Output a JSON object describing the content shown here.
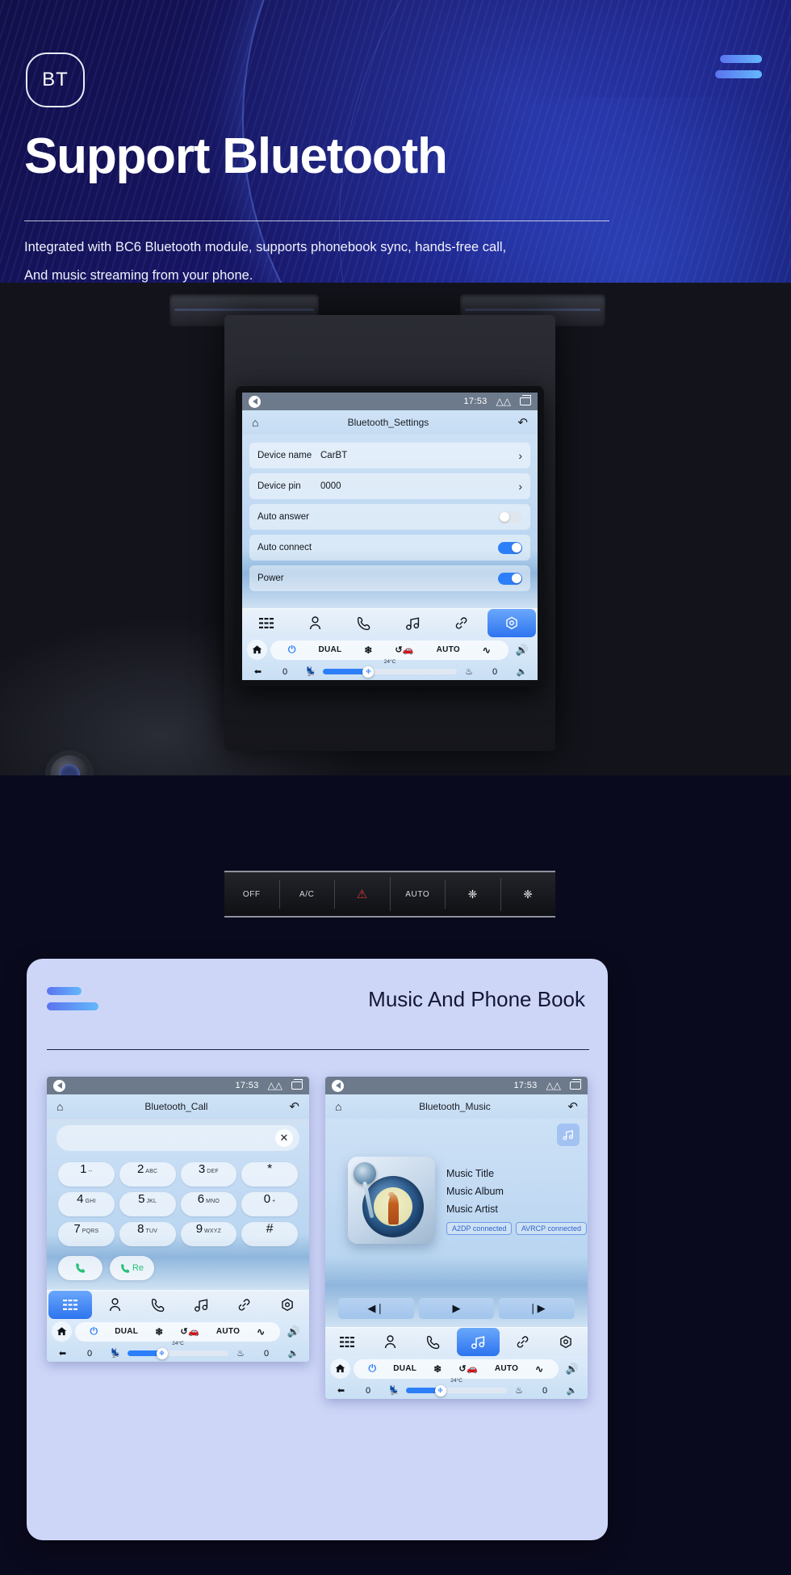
{
  "hero": {
    "badge": "BT",
    "title": "Support Bluetooth",
    "subtitle_line1": "Integrated with BC6 Bluetooth module, supports phonebook sync, hands-free call,",
    "subtitle_line2": "And music streaming from your phone.",
    "accent": "#5b74f0",
    "accent2": "#63b8fb",
    "bg": "#161460"
  },
  "car_hvac": {
    "buttons": [
      "OFF",
      "A/C",
      "⚠",
      "AUTO",
      "❈",
      "❈"
    ]
  },
  "settings_screen": {
    "status": {
      "time": "17:53"
    },
    "title": "Bluetooth_Settings",
    "rows": [
      {
        "label": "Device name",
        "value": "CarBT",
        "type": "chevron"
      },
      {
        "label": "Device pin",
        "value": "0000",
        "type": "chevron"
      },
      {
        "label": "Auto answer",
        "value": "",
        "type": "toggle",
        "on": false
      },
      {
        "label": "Auto connect",
        "value": "",
        "type": "toggle",
        "on": true
      },
      {
        "label": "Power",
        "value": "",
        "type": "toggle",
        "on": true
      }
    ],
    "dock_active": "settings",
    "climate": {
      "dual": "DUAL",
      "auto": "AUTO",
      "temp": "24°C",
      "left_level": "0",
      "right_level": "0"
    }
  },
  "card": {
    "title": "Music And Phone Book"
  },
  "call_screen": {
    "status": {
      "time": "17:53"
    },
    "title": "Bluetooth_Call",
    "search_value": "",
    "keys": [
      {
        "d": "1",
        "s": "--"
      },
      {
        "d": "2",
        "s": "ABC"
      },
      {
        "d": "3",
        "s": "DEF"
      },
      {
        "d": "*",
        "s": ""
      },
      {
        "d": "4",
        "s": "GHI"
      },
      {
        "d": "5",
        "s": "JKL"
      },
      {
        "d": "6",
        "s": "MNO"
      },
      {
        "d": "0",
        "s": "+"
      },
      {
        "d": "7",
        "s": "PQRS"
      },
      {
        "d": "8",
        "s": "TUV"
      },
      {
        "d": "9",
        "s": "WXYZ"
      },
      {
        "d": "#",
        "s": ""
      }
    ],
    "call_label": "",
    "redial_label": "Re",
    "dock_active": "apps",
    "climate": {
      "dual": "DUAL",
      "auto": "AUTO",
      "temp": "24°C",
      "left_level": "0",
      "right_level": "0"
    }
  },
  "music_screen": {
    "status": {
      "time": "17:53"
    },
    "title": "Bluetooth_Music",
    "track": {
      "title": "Music Title",
      "album": "Music Album",
      "artist": "Music Artist"
    },
    "badges": [
      "A2DP  connected",
      "AVRCP connected"
    ],
    "controls": {
      "prev": "◀❘",
      "play": "▶",
      "next": "❘▶"
    },
    "dock_active": "music",
    "climate": {
      "dual": "DUAL",
      "auto": "AUTO",
      "temp": "24°C",
      "left_level": "0",
      "right_level": "0"
    }
  }
}
